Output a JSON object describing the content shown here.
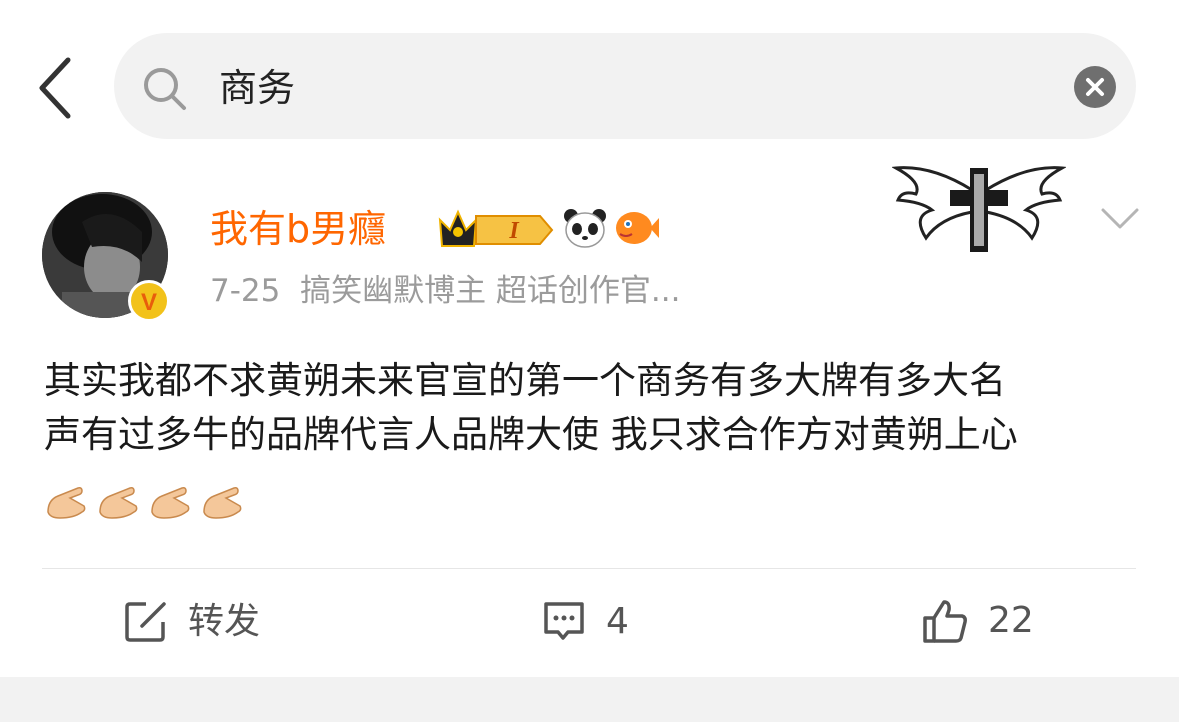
{
  "search": {
    "query": "商务"
  },
  "post": {
    "username": "我有b男癮",
    "level_badge": "I",
    "date": "7-25",
    "tags": "搞笑幽默博主 超话创作官...",
    "text_line1": "其实我都不求黄朔未来官宣的第一个商务有多大牌有多大名",
    "text_line2": "声有过多牛的品牌代言人品牌大使 我只求合作方对黄朔上心",
    "emojis": "🫳🫳🫳🫳"
  },
  "actions": {
    "repost_label": "转发",
    "comment_count": "4",
    "like_count": "22"
  },
  "colors": {
    "username": "#ff6600",
    "meta": "#9b9b9b",
    "search_bg": "#f2f2f2"
  }
}
